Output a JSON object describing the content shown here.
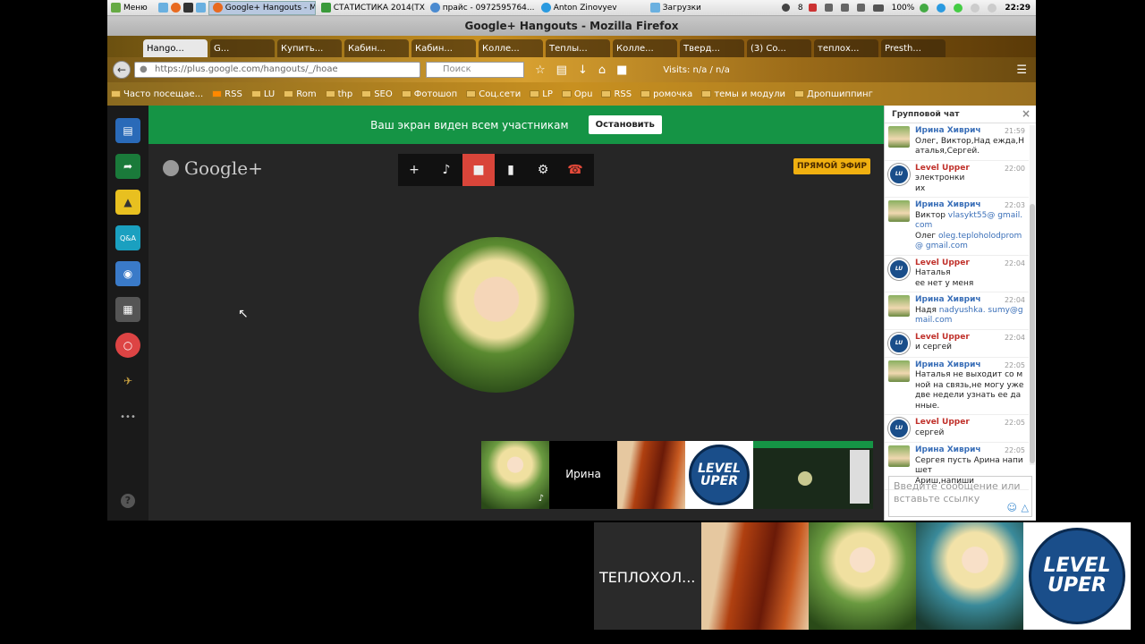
{
  "taskbar": {
    "menu": "Меню",
    "windows": [
      "Google+ Hangouts - M...",
      "СТАТИСТИКА 2014(ТХ...",
      "прайс - 0972595764...",
      "Anton Zinovyev",
      "Загрузки"
    ],
    "tray_count": "8",
    "battery": "100%",
    "clock": "22:29"
  },
  "firefox": {
    "title": "Google+ Hangouts - Mozilla Firefox",
    "tabs": [
      "Hango...",
      "G...",
      "Купить...",
      "Кабин...",
      "Кабин...",
      "Колле...",
      "Теплы...",
      "Колле...",
      "Тверд...",
      "(3) Co...",
      "теплох...",
      "Presth..."
    ],
    "url": "https://plus.google.com/hangouts/_/hoae",
    "search_placeholder": "Поиск",
    "visits": "Visits: n/a / n/a",
    "bookmarks": [
      "Часто посещае...",
      "RSS",
      "LU",
      "Rom",
      "thp",
      "SEO",
      "Фотошоп",
      "Соц.сети",
      "LP",
      "Opu",
      "RSS",
      "ромочка",
      "темы и модули",
      "Дропшиппинг"
    ]
  },
  "hangout": {
    "share_notice": "Ваш экран виден всем участникам",
    "stop_label": "Остановить",
    "logo": "Google+",
    "live_label": "ПРЯМОЙ ЭФИР",
    "filmstrip_name": "Ирина",
    "level_top": "LEVEL",
    "level_bottom": "UPER",
    "help": "?",
    "more": "•••",
    "qa": "Q&A"
  },
  "chat": {
    "title": "Групповой чат",
    "input_placeholder": "Введите сообщение или вставьте ссылку",
    "messages": [
      {
        "author": "Ирина Хиврич",
        "time": "21:59",
        "text": "Олег, Виктор,Над ежда,Наталья,Сергей."
      },
      {
        "author": "Level Upper",
        "time": "22:00",
        "text": "электронки\nих"
      },
      {
        "author": "Ирина Хиврич",
        "time": "22:03",
        "line1": "Виктор ",
        "link1": "vlasykt55@ gmail.com",
        "line2": "Олег ",
        "link2": "oleg.teploholodprom@ gmail.com"
      },
      {
        "author": "Level Upper",
        "time": "22:04",
        "text": "Наталья\nее нет у меня"
      },
      {
        "author": "Ирина Хиврич",
        "time": "22:04",
        "line1": "Надя ",
        "link1": "nadyushka. sumy@gmail.com"
      },
      {
        "author": "Level Upper",
        "time": "22:04",
        "text": "и сергей"
      },
      {
        "author": "Ирина Хиврич",
        "time": "22:05",
        "text": "Наталья не выходит со мной на связь,не могу уже две недели узнать ее данные."
      },
      {
        "author": "Level Upper",
        "time": "22:05",
        "text": "сергей"
      },
      {
        "author": "Ирина Хиврич",
        "time": "22:05",
        "text": "Сергея пусть Арина напишет\nАриш,напиши"
      }
    ]
  },
  "bottom_strip": {
    "name_tile": "ТЕПЛОХОЛ..."
  },
  "colors": {
    "share_green": "#159445",
    "live_yellow": "#f0b010",
    "camera_off_red": "#d9453a"
  }
}
